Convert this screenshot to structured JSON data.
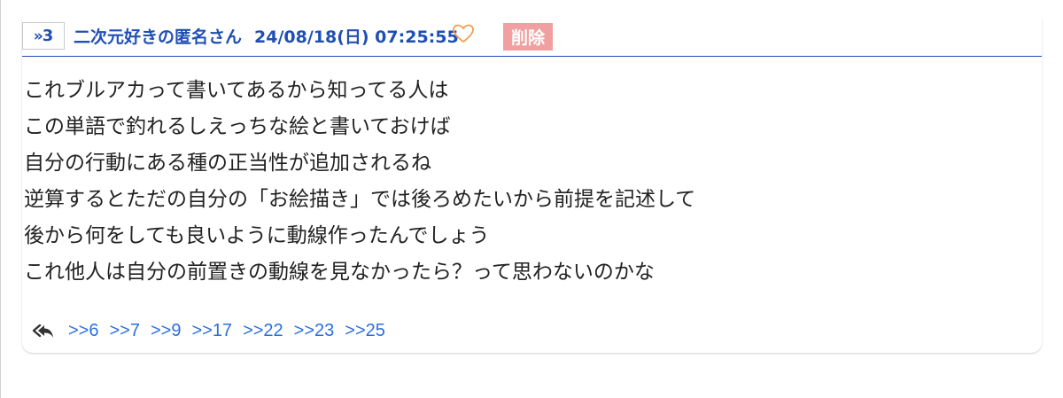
{
  "post": {
    "number_prefix": "»",
    "number": "3",
    "name": "二次元好きの匿名さん",
    "date": "24/08/18(日) 07:25:55",
    "like_icon": "heart-outline-icon",
    "delete_label": "削除",
    "body_lines": [
      "これブルアカって書いてあるから知ってる人は",
      "この単語で釣れるしえっちな絵と書いておけば",
      "自分の行動にある種の正当性が追加されるね",
      "逆算するとただの自分の「お絵描き」では後ろめたいから前提を記述して",
      "後から何をしても良いように動線作ったんでしょう",
      "これ他人は自分の前置きの動線を見なかったら？って思わないのかな"
    ],
    "reply_icon": "reply-all-icon",
    "replies": [
      ">>6",
      ">>7",
      ">>9",
      ">>17",
      ">>22",
      ">>23",
      ">>25"
    ]
  },
  "colors": {
    "accent": "#1f4fb5",
    "link": "#2a6fe0",
    "like": "#f0a050",
    "delete_bg": "#f0a0a0"
  }
}
